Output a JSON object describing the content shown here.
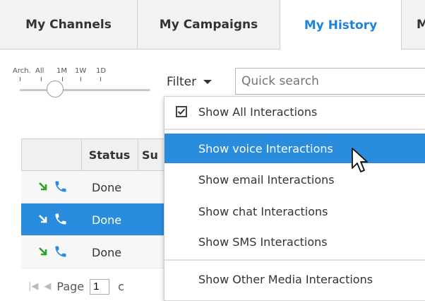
{
  "tabs": [
    {
      "label": "My Channels"
    },
    {
      "label": "My Campaigns"
    },
    {
      "label": "My History",
      "active": true
    },
    {
      "label": "M"
    }
  ],
  "time_slider": {
    "labels": [
      "Arch.",
      "All",
      "1M",
      "1W",
      "1D"
    ],
    "selected": "All"
  },
  "filter": {
    "label": "Filter"
  },
  "search": {
    "placeholder": "Quick search"
  },
  "grid": {
    "headers": [
      "",
      "Status",
      "Su"
    ],
    "rows": [
      {
        "status": "Done",
        "selected": false
      },
      {
        "status": "Done",
        "selected": true
      },
      {
        "status": "Done",
        "selected": false
      }
    ]
  },
  "pager": {
    "page_label": "Page",
    "page_value": "1",
    "of_fragment": "c"
  },
  "menu": {
    "items": [
      {
        "label": "Show All Interactions",
        "checked": true
      },
      {
        "label": "Show voice Interactions",
        "highlighted": true
      },
      {
        "label": "Show email Interactions"
      },
      {
        "label": "Show chat Interactions"
      },
      {
        "label": "Show SMS Interactions"
      },
      {
        "label": "Show Other Media Interactions"
      }
    ]
  },
  "colors": {
    "accent": "#1e82d8",
    "selection": "#2a8cdc",
    "interaction_icon_green": "#2aa12a",
    "tabbar_bg": "#f2f2f2"
  },
  "icons": {
    "inbound_arrow": "arrow-down-right-icon",
    "voice": "phone-icon",
    "checkbox": "checkbox-checked-icon",
    "caret": "caret-down-icon",
    "pointer": "mouse-pointer-icon"
  }
}
